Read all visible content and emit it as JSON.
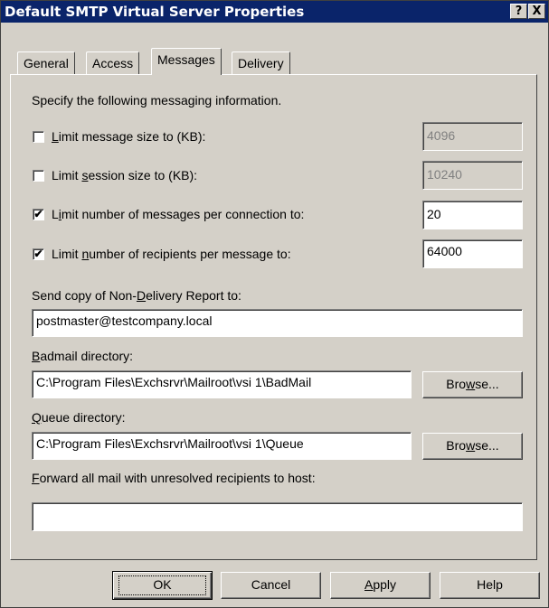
{
  "window": {
    "title": "Default SMTP Virtual Server Properties",
    "help_label": "?",
    "close_label": "X"
  },
  "tabs": [
    {
      "label": "General"
    },
    {
      "label": "Access"
    },
    {
      "label": "Messages",
      "active": true
    },
    {
      "label": "Delivery"
    }
  ],
  "messages": {
    "intro": "Specify the following messaging information.",
    "limit_size": {
      "pre": "",
      "key": "L",
      "post": "imit message size to (KB):",
      "checked": false,
      "check_glyph": "",
      "value": "4096",
      "enabled": false
    },
    "limit_session": {
      "pre": "Limit ",
      "key": "s",
      "post": "ession size to (KB):",
      "checked": false,
      "check_glyph": "",
      "value": "10240",
      "enabled": false
    },
    "limit_messages": {
      "pre": "L",
      "key": "i",
      "post": "mit number of messages per connection to:",
      "checked": true,
      "check_glyph": "✔",
      "value": "20",
      "enabled": true
    },
    "limit_recipients": {
      "pre": "Limit ",
      "key": "n",
      "post": "umber of recipients per message to:",
      "checked": true,
      "check_glyph": "✔",
      "value": "64000",
      "enabled": true
    },
    "ndr": {
      "pre": "Send copy of Non-",
      "key": "D",
      "post": "elivery Report to:",
      "value": "postmaster@testcompany.local"
    },
    "badmail": {
      "pre": "",
      "key": "B",
      "post": "admail directory:",
      "value": "C:\\Program Files\\Exchsrvr\\Mailroot\\vsi 1\\BadMail"
    },
    "queue": {
      "pre": "",
      "key": "Q",
      "post": "ueue directory:",
      "value": "C:\\Program Files\\Exchsrvr\\Mailroot\\vsi 1\\Queue"
    },
    "forward": {
      "pre": "",
      "key": "F",
      "post": "orward all mail with unresolved recipients to host:",
      "value": ""
    },
    "browse": {
      "pre": "Bro",
      "key": "w",
      "post": "se..."
    }
  },
  "buttons": {
    "ok": "OK",
    "cancel": "Cancel",
    "apply": {
      "pre": "",
      "key": "A",
      "post": "pply"
    },
    "help": "Help"
  },
  "colors": {
    "title_bar": "#0a246a",
    "face": "#d4d0c8"
  }
}
